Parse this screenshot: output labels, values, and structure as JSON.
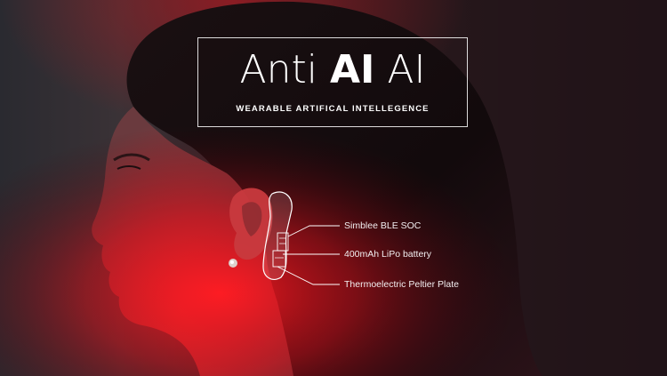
{
  "hero": {
    "title_part1": "Anti ",
    "title_part2": "AI",
    "title_part3": " AI",
    "subtitle": "WEARABLE ARTIFICAL INTELLEGENCE"
  },
  "callouts": [
    {
      "label": "Simblee BLE SOC"
    },
    {
      "label": "400mAh LiPo battery"
    },
    {
      "label": "Thermoelectric Peltier Plate"
    }
  ],
  "colors": {
    "accent_red": "#e0121c",
    "text": "#ffffff",
    "background": "#1a1418"
  }
}
